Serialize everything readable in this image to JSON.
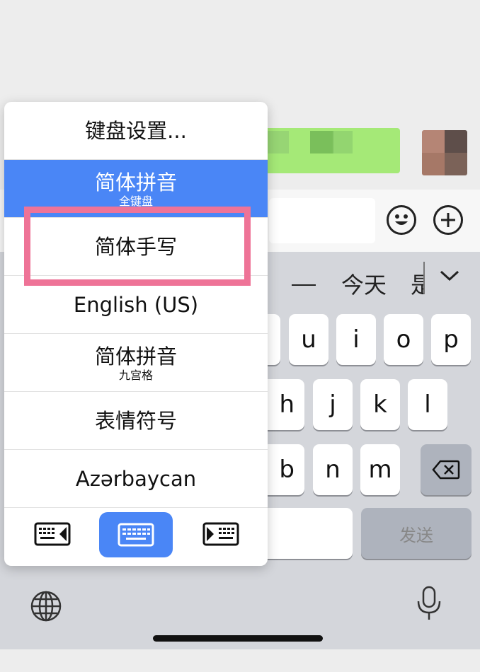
{
  "popup": {
    "items": [
      {
        "label": "键盘设置...",
        "sub": ""
      },
      {
        "label": "简体拼音",
        "sub": "全键盘"
      },
      {
        "label": "简体手写",
        "sub": ""
      },
      {
        "label": "English (US)",
        "sub": ""
      },
      {
        "label": "简体拼音",
        "sub": "九宫格"
      },
      {
        "label": "表情符号",
        "sub": ""
      },
      {
        "label": "Azərbaycan",
        "sub": ""
      }
    ],
    "selected_index": 1,
    "highlighted_index": 2
  },
  "candidates": [
    "今天",
    "是"
  ],
  "keyboard": {
    "row1": [
      "u",
      "i",
      "o",
      "p"
    ],
    "row2": [
      "h",
      "j",
      "k",
      "l"
    ],
    "row3": [
      "b",
      "n",
      "m"
    ],
    "send_label": "发送"
  },
  "icons": [
    "emoji-icon",
    "plus-icon",
    "chevron-down-icon",
    "backspace-icon",
    "globe-icon",
    "microphone-icon",
    "keyboard-left-icon",
    "keyboard-full-icon",
    "keyboard-right-icon"
  ],
  "colors": {
    "accent": "#4a86f6",
    "highlight": "#ee7397",
    "bubble": "#a5e977"
  }
}
